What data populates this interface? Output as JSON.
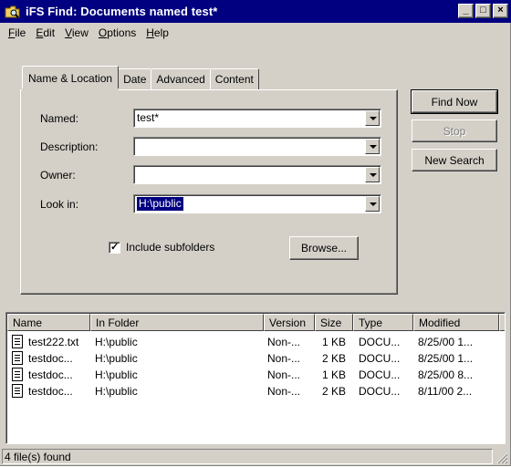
{
  "window": {
    "title": "iFS Find: Documents named test*"
  },
  "titlebar_buttons": [
    {
      "name": "minimize",
      "glyph": "_"
    },
    {
      "name": "maximize",
      "glyph": "□"
    },
    {
      "name": "close",
      "glyph": "×"
    }
  ],
  "menu": [
    {
      "label": "File",
      "underline": "F"
    },
    {
      "label": "Edit",
      "underline": "E"
    },
    {
      "label": "View",
      "underline": "V"
    },
    {
      "label": "Options",
      "underline": "O"
    },
    {
      "label": "Help",
      "underline": "H"
    }
  ],
  "tabs": [
    {
      "label": "Name & Location",
      "active": true
    },
    {
      "label": "Date",
      "active": false
    },
    {
      "label": "Advanced",
      "active": false
    },
    {
      "label": "Content",
      "active": false
    }
  ],
  "form": {
    "named": {
      "label": "Named:",
      "value": "test*"
    },
    "description": {
      "label": "Description:",
      "value": ""
    },
    "owner": {
      "label": "Owner:",
      "value": ""
    },
    "look_in": {
      "label": "Look in:",
      "value": "H:\\public"
    },
    "include_subfolders": {
      "label": "Include subfolders",
      "checked": true
    },
    "browse_label": "Browse..."
  },
  "actions": {
    "find_now": "Find Now",
    "stop": "Stop",
    "new_search": "New Search"
  },
  "results": {
    "columns": [
      "Name",
      "In Folder",
      "Version",
      "Size",
      "Type",
      "Modified"
    ],
    "rows": [
      {
        "name": "test222.txt",
        "folder": "H:\\public",
        "version": "Non-...",
        "size": "1 KB",
        "type": "DOCU...",
        "modified": "8/25/00 1..."
      },
      {
        "name": "testdoc...",
        "folder": "H:\\public",
        "version": "Non-...",
        "size": "2 KB",
        "type": "DOCU...",
        "modified": "8/25/00 1..."
      },
      {
        "name": "testdoc...",
        "folder": "H:\\public",
        "version": "Non-...",
        "size": "1 KB",
        "type": "DOCU...",
        "modified": "8/25/00 8..."
      },
      {
        "name": "testdoc...",
        "folder": "H:\\public",
        "version": "Non-...",
        "size": "2 KB",
        "type": "DOCU...",
        "modified": "8/11/00 2..."
      }
    ]
  },
  "status": {
    "text": "4 file(s) found"
  },
  "colors": {
    "titlebar": "#000080",
    "face": "#d4d0c8",
    "selection": "#000080"
  }
}
